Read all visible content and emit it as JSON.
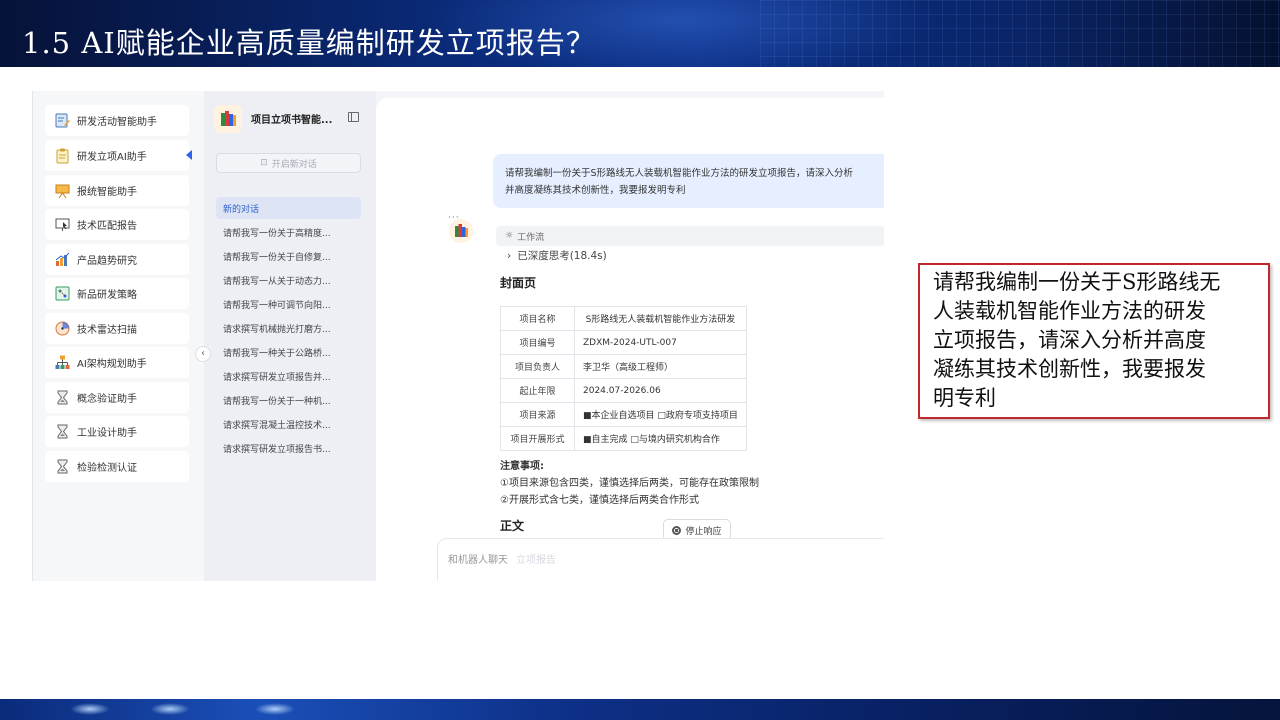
{
  "slide": {
    "title": "1.5  AI赋能企业高质量编制研发立项报告？"
  },
  "sidebar": {
    "items": [
      {
        "label": "研发活动智能助手",
        "icon": "document-edit-icon"
      },
      {
        "label": "研发立项AI助手",
        "icon": "clipboard-icon",
        "active": true
      },
      {
        "label": "报统智能助手",
        "icon": "presentation-board-icon"
      },
      {
        "label": "技术匹配报告",
        "icon": "monitor-cursor-icon"
      },
      {
        "label": "产品趋势研究",
        "icon": "trend-chart-icon"
      },
      {
        "label": "新品研发策略",
        "icon": "strategy-board-icon"
      },
      {
        "label": "技术雷达扫描",
        "icon": "radar-icon"
      },
      {
        "label": "AI架构规划助手",
        "icon": "org-structure-icon"
      },
      {
        "label": "概念验证助手",
        "icon": "hourglass-icon"
      },
      {
        "label": "工业设计助手",
        "icon": "hourglass-icon"
      },
      {
        "label": "检验检测认证",
        "icon": "hourglass-icon"
      }
    ]
  },
  "history": {
    "header_title": "项目立项书智能...",
    "new_chat_label": "开启新对话",
    "items": [
      "新的对话",
      "请帮我写一份关于高精度...",
      "请帮我写一份关于自修复...",
      "请帮我写一从关于动态力...",
      "请帮我写一种可调节向阳...",
      "请求撰写机械抛光打磨方...",
      "请帮我写一种关于公路桥...",
      "请求撰写研发立项报告并...",
      "请帮我写一份关于一种机...",
      "请求撰写混凝土温控技术...",
      "请求撰写研发立项报告书..."
    ]
  },
  "chat": {
    "user_message_line1": "请帮我编制一份关于S形路线无人装载机智能作业方法的研发立项报告，请深入分析",
    "user_message_line2": "并高度凝练其技术创新性，我要报发明专利",
    "workflow_label": "工作流",
    "thinking_label": "已深度思考(18.4s)",
    "cover_heading": "封面页",
    "table": [
      {
        "key": "项目名称",
        "value": "S形路线无人装载机智能作业方法研发"
      },
      {
        "key": "项目编号",
        "value": "ZDXM-2024-UTL-007"
      },
      {
        "key": "项目负责人",
        "value": "李卫华（高级工程师）"
      },
      {
        "key": "起止年限",
        "value": "2024.07-2026.06"
      },
      {
        "key": "项目来源",
        "value": "■本企业自选项目 □政府专项支持项目"
      },
      {
        "key": "项目开展形式",
        "value": "■自主完成 □与境内研究机构合作"
      }
    ],
    "notes_title": "注意事项:",
    "notes": [
      "①项目来源包含四类，谨慎选择后两类，可能存在政策限制",
      "②开展形式含七类，谨慎选择后两类合作形式"
    ],
    "body_heading": "正文",
    "stop_label": "停止响应",
    "input_placeholder": "和机器人聊天",
    "input_faded": "立项报告"
  },
  "callout": {
    "lines": [
      "请帮我编制一份关于S形路线无",
      "人装载机智能作业方法的研发",
      "立项报告，请深入分析并高度",
      "凝练其技术创新性，我要报发",
      "明专利"
    ]
  },
  "colors": {
    "accent": "#2f63e6",
    "callout_border": "#c0282d",
    "banner": "#0a2a78"
  }
}
